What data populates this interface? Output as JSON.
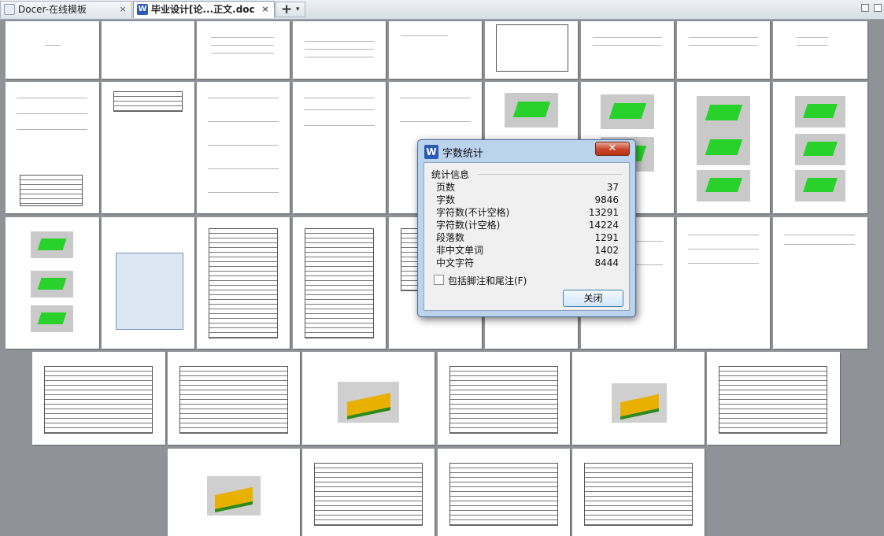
{
  "tabs": [
    {
      "label": "Docer-在线模板",
      "icon": "docer-icon",
      "active": false
    },
    {
      "label": "毕业设计[论...正文.doc",
      "icon": "word-doc-icon",
      "active": true
    }
  ],
  "tab_close_symbol": "×",
  "new_tab_symbol": "+",
  "new_tab_menu_symbol": "▾",
  "dialog": {
    "app_icon_letter": "W",
    "title": "字数统计",
    "close_symbol": "✕",
    "group_label": "统计信息",
    "rows": [
      {
        "label": "页数",
        "value": "37"
      },
      {
        "label": "字数",
        "value": "9846"
      },
      {
        "label": "字符数(不计空格)",
        "value": "13291"
      },
      {
        "label": "字符数(计空格)",
        "value": "14224"
      },
      {
        "label": "段落数",
        "value": "1291"
      },
      {
        "label": "非中文单词",
        "value": "1402"
      },
      {
        "label": "中文字符",
        "value": "8444"
      }
    ],
    "checkbox_label": "包括脚注和尾注(F)",
    "checkbox_checked": false,
    "close_button": "关闭"
  },
  "colors": {
    "accent": "#2b5bb5",
    "close_red": "#c9452a",
    "dialog_frame": "#bcd3ee",
    "model_green": "#29d22b",
    "model_yellow": "#e8b000"
  }
}
